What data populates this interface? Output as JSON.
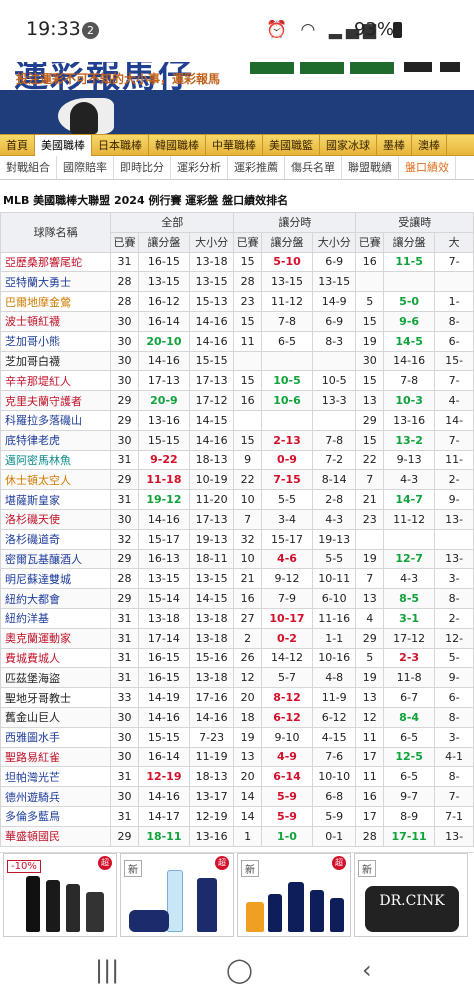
{
  "status_bar": {
    "time": "19:33",
    "notifications": "2",
    "battery": "93%"
  },
  "banner": {
    "logo_text": "運彩報馬仔",
    "slogan": "投注運彩不可不知的大小事，運彩報馬"
  },
  "nav_primary": [
    {
      "label": "首頁",
      "active": false
    },
    {
      "label": "美國職棒",
      "active": true
    },
    {
      "label": "日本職棒",
      "active": false
    },
    {
      "label": "韓國職棒",
      "active": false
    },
    {
      "label": "中華職棒",
      "active": false
    },
    {
      "label": "美國職籃",
      "active": false
    },
    {
      "label": "國家冰球",
      "active": false
    },
    {
      "label": "墨棒",
      "active": false
    },
    {
      "label": "澳棒",
      "active": false
    }
  ],
  "nav_secondary": [
    {
      "label": "對戰組合",
      "active": false
    },
    {
      "label": "國際賠率",
      "active": false
    },
    {
      "label": "即時比分",
      "active": false
    },
    {
      "label": "運彩分析",
      "active": false
    },
    {
      "label": "運彩推薦",
      "active": false
    },
    {
      "label": "傷兵名單",
      "active": false
    },
    {
      "label": "聯盟戰績",
      "active": false
    },
    {
      "label": "盤口績效",
      "active": true
    }
  ],
  "page_title": "MLB 美國職棒大聯盟 2024 例行賽 運彩盤 盤口績效排名",
  "table": {
    "group_headers": [
      "全部",
      "讓分時",
      "受讓時"
    ],
    "team_header": "球隊名稱",
    "sub_headers": [
      "已賽",
      "讓分盤",
      "大小分",
      "已賽",
      "讓分盤",
      "大小分",
      "已賽",
      "讓分盤",
      "大"
    ],
    "rows": [
      {
        "team": "亞歷桑那響尾蛇",
        "color": "red",
        "c": [
          "31",
          "16-15",
          "13-18",
          "15",
          "5-10",
          "6-9",
          "16",
          "11-5",
          "7-"
        ],
        "hl": {
          "4": "red",
          "7": "green"
        }
      },
      {
        "team": "亞特蘭大勇士",
        "color": "blue",
        "c": [
          "28",
          "13-15",
          "13-15",
          "28",
          "13-15",
          "13-15",
          "",
          "",
          ""
        ],
        "hl": {}
      },
      {
        "team": "巴爾地摩金鶯",
        "color": "orange",
        "c": [
          "28",
          "16-12",
          "15-13",
          "23",
          "11-12",
          "14-9",
          "5",
          "5-0",
          "1-"
        ],
        "hl": {
          "7": "green"
        }
      },
      {
        "team": "波士頓紅襪",
        "color": "red",
        "c": [
          "30",
          "16-14",
          "14-16",
          "15",
          "7-8",
          "6-9",
          "15",
          "9-6",
          "8-"
        ],
        "hl": {
          "7": "green"
        }
      },
      {
        "team": "芝加哥小熊",
        "color": "blue",
        "c": [
          "30",
          "20-10",
          "14-16",
          "11",
          "6-5",
          "8-3",
          "19",
          "14-5",
          "6-"
        ],
        "hl": {
          "1": "green",
          "7": "green"
        }
      },
      {
        "team": "芝加哥白襪",
        "color": "black",
        "c": [
          "30",
          "14-16",
          "15-15",
          "",
          "",
          "",
          "30",
          "14-16",
          "15-"
        ],
        "hl": {}
      },
      {
        "team": "辛辛那堤紅人",
        "color": "red",
        "c": [
          "30",
          "17-13",
          "17-13",
          "15",
          "10-5",
          "10-5",
          "15",
          "7-8",
          "7-"
        ],
        "hl": {
          "4": "green"
        }
      },
      {
        "team": "克里夫蘭守護者",
        "color": "red",
        "c": [
          "29",
          "20-9",
          "17-12",
          "16",
          "10-6",
          "13-3",
          "13",
          "10-3",
          "4-"
        ],
        "hl": {
          "1": "green",
          "4": "green",
          "7": "green"
        }
      },
      {
        "team": "科羅拉多落磯山",
        "color": "blue",
        "c": [
          "29",
          "13-16",
          "14-15",
          "",
          "",
          "",
          "29",
          "13-16",
          "14-"
        ],
        "hl": {}
      },
      {
        "team": "底特律老虎",
        "color": "blue",
        "c": [
          "30",
          "15-15",
          "14-16",
          "15",
          "2-13",
          "7-8",
          "15",
          "13-2",
          "7-"
        ],
        "hl": {
          "4": "red",
          "7": "green"
        }
      },
      {
        "team": "邁阿密馬林魚",
        "color": "teal",
        "c": [
          "31",
          "9-22",
          "18-13",
          "9",
          "0-9",
          "7-2",
          "22",
          "9-13",
          "11-"
        ],
        "hl": {
          "1": "red",
          "4": "red"
        }
      },
      {
        "team": "休士頓太空人",
        "color": "orange",
        "c": [
          "29",
          "11-18",
          "10-19",
          "22",
          "7-15",
          "8-14",
          "7",
          "4-3",
          "2-"
        ],
        "hl": {
          "1": "red",
          "4": "red"
        }
      },
      {
        "team": "堪薩斯皇家",
        "color": "blue",
        "c": [
          "31",
          "19-12",
          "11-20",
          "10",
          "5-5",
          "2-8",
          "21",
          "14-7",
          "9-"
        ],
        "hl": {
          "1": "green",
          "7": "green"
        }
      },
      {
        "team": "洛杉磯天使",
        "color": "red",
        "c": [
          "30",
          "14-16",
          "17-13",
          "7",
          "3-4",
          "4-3",
          "23",
          "11-12",
          "13-"
        ],
        "hl": {}
      },
      {
        "team": "洛杉磯道奇",
        "color": "blue",
        "c": [
          "32",
          "15-17",
          "19-13",
          "32",
          "15-17",
          "19-13",
          "",
          "",
          ""
        ],
        "hl": {}
      },
      {
        "team": "密爾瓦基釀酒人",
        "color": "blue",
        "c": [
          "29",
          "16-13",
          "18-11",
          "10",
          "4-6",
          "5-5",
          "19",
          "12-7",
          "13-"
        ],
        "hl": {
          "4": "red",
          "7": "green"
        }
      },
      {
        "team": "明尼蘇達雙城",
        "color": "blue",
        "c": [
          "28",
          "13-15",
          "13-15",
          "21",
          "9-12",
          "10-11",
          "7",
          "4-3",
          "3-"
        ],
        "hl": {}
      },
      {
        "team": "紐約大都會",
        "color": "blue",
        "c": [
          "29",
          "15-14",
          "14-15",
          "16",
          "7-9",
          "6-10",
          "13",
          "8-5",
          "8-"
        ],
        "hl": {
          "7": "green"
        }
      },
      {
        "team": "紐約洋基",
        "color": "blue",
        "c": [
          "31",
          "13-18",
          "13-18",
          "27",
          "10-17",
          "11-16",
          "4",
          "3-1",
          "2-"
        ],
        "hl": {
          "4": "red",
          "7": "green"
        }
      },
      {
        "team": "奧克蘭運動家",
        "color": "red",
        "c": [
          "31",
          "17-14",
          "13-18",
          "2",
          "0-2",
          "1-1",
          "29",
          "17-12",
          "12-"
        ],
        "hl": {
          "4": "red"
        }
      },
      {
        "team": "費城費城人",
        "color": "red",
        "c": [
          "31",
          "16-15",
          "15-16",
          "26",
          "14-12",
          "10-16",
          "5",
          "2-3",
          "5-"
        ],
        "hl": {
          "7": "red"
        }
      },
      {
        "team": "匹茲堡海盜",
        "color": "black",
        "c": [
          "31",
          "16-15",
          "13-18",
          "12",
          "5-7",
          "4-8",
          "19",
          "11-8",
          "9-"
        ],
        "hl": {}
      },
      {
        "team": "聖地牙哥教士",
        "color": "black",
        "c": [
          "33",
          "14-19",
          "17-16",
          "20",
          "8-12",
          "11-9",
          "13",
          "6-7",
          "6-"
        ],
        "hl": {
          "4": "red"
        }
      },
      {
        "team": "舊金山巨人",
        "color": "black",
        "c": [
          "30",
          "14-16",
          "14-16",
          "18",
          "6-12",
          "6-12",
          "12",
          "8-4",
          "8-"
        ],
        "hl": {
          "4": "red",
          "7": "green"
        }
      },
      {
        "team": "西雅圖水手",
        "color": "blue",
        "c": [
          "30",
          "15-15",
          "7-23",
          "19",
          "9-10",
          "4-15",
          "11",
          "6-5",
          "3-"
        ],
        "hl": {}
      },
      {
        "team": "聖路易紅雀",
        "color": "red",
        "c": [
          "30",
          "16-14",
          "11-19",
          "13",
          "4-9",
          "7-6",
          "17",
          "12-5",
          "4-1"
        ],
        "hl": {
          "4": "red",
          "7": "green"
        }
      },
      {
        "team": "坦帕灣光芒",
        "color": "blue",
        "c": [
          "31",
          "12-19",
          "18-13",
          "20",
          "6-14",
          "10-10",
          "11",
          "6-5",
          "8-"
        ],
        "hl": {
          "1": "red",
          "4": "red"
        }
      },
      {
        "team": "德州遊騎兵",
        "color": "blue",
        "c": [
          "30",
          "14-16",
          "13-17",
          "14",
          "5-9",
          "6-8",
          "16",
          "9-7",
          "7-"
        ],
        "hl": {
          "4": "red"
        }
      },
      {
        "team": "多倫多藍鳥",
        "color": "blue",
        "c": [
          "31",
          "14-17",
          "12-19",
          "14",
          "5-9",
          "5-9",
          "17",
          "8-9",
          "7-1"
        ],
        "hl": {
          "4": "red"
        }
      },
      {
        "team": "華盛頓國民",
        "color": "red",
        "c": [
          "29",
          "18-11",
          "13-16",
          "1",
          "1-0",
          "0-1",
          "28",
          "17-11",
          "13-"
        ],
        "hl": {
          "1": "green",
          "4": "green",
          "7": "green"
        }
      }
    ]
  },
  "ads": [
    {
      "tag": "-10%",
      "tag_style": "red"
    },
    {
      "tag": "新",
      "tag_style": "plain"
    },
    {
      "tag": "新",
      "tag_style": "plain"
    },
    {
      "tag": "新",
      "tag_style": "plain",
      "brand": "DR.CINK"
    }
  ],
  "colors": {
    "nav_gold": "#e8b43a",
    "header_blue": "#1e3d7a",
    "loss_red": "#d3102b",
    "win_green": "#11a33b"
  }
}
